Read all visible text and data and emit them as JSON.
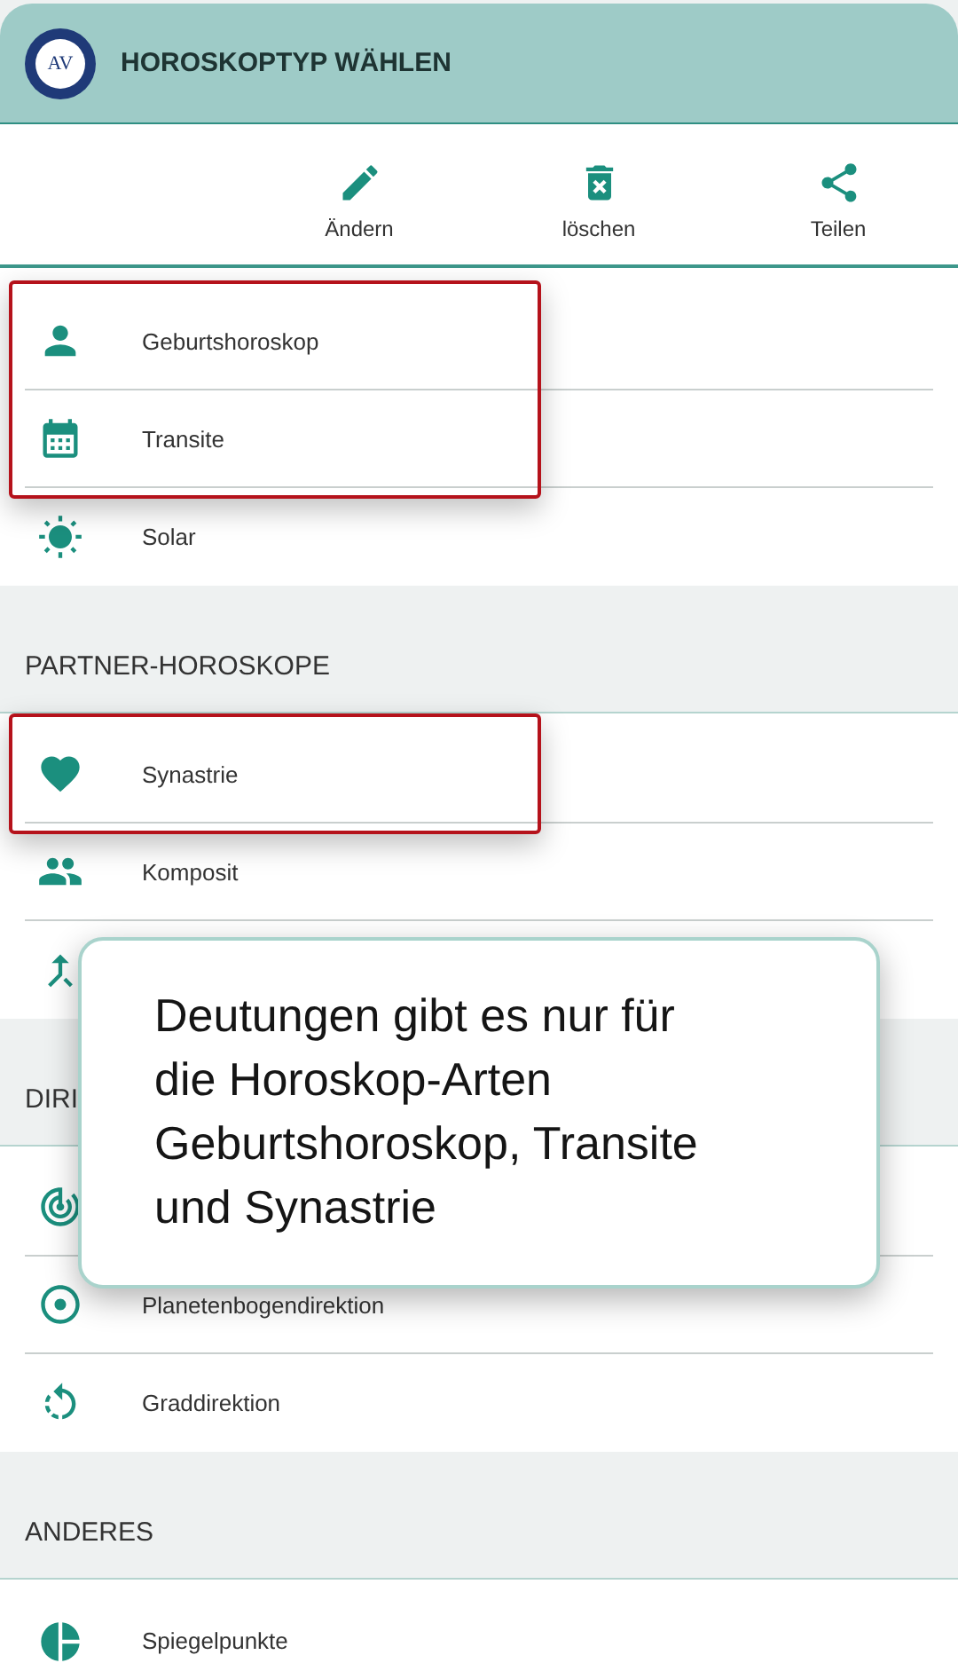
{
  "header": {
    "logo_text": "AV",
    "title": "HOROSKOPTYP WÄHLEN"
  },
  "actions": [
    {
      "kind": "edit",
      "label": "Ändern"
    },
    {
      "kind": "delete",
      "label": "löschen"
    },
    {
      "kind": "share",
      "label": "Teilen"
    }
  ],
  "sections": [
    {
      "rows": [
        {
          "kind": "person",
          "label": "Geburtshoroskop",
          "highlighted": true
        },
        {
          "kind": "calendar",
          "label": "Transite",
          "highlighted": true
        },
        {
          "kind": "sun",
          "label": "Solar",
          "highlighted": false
        }
      ]
    },
    {
      "title": "PARTNER-HOROSKOPE",
      "rows": [
        {
          "kind": "heart",
          "label": "Synastrie",
          "highlighted": true
        },
        {
          "kind": "people",
          "label": "Komposit",
          "highlighted": false
        },
        {
          "kind": "merge",
          "highlighted": false
        }
      ]
    },
    {
      "title": "DIRI",
      "rows": [
        {
          "kind": "rings",
          "highlighted": false
        },
        {
          "kind": "dot",
          "label": "Planetenbogendirektion",
          "highlighted": false
        },
        {
          "kind": "degree",
          "label": "Graddirektion",
          "highlighted": false
        }
      ]
    },
    {
      "title": "ANDERES",
      "rows": [
        {
          "kind": "pie",
          "label": "Spiegelpunkte",
          "highlighted": false
        }
      ]
    }
  ],
  "callout": {
    "text": "Deutungen gibt es nur für die Horoskop-Arten Geburtshoroskop, Transite und Synastrie"
  }
}
